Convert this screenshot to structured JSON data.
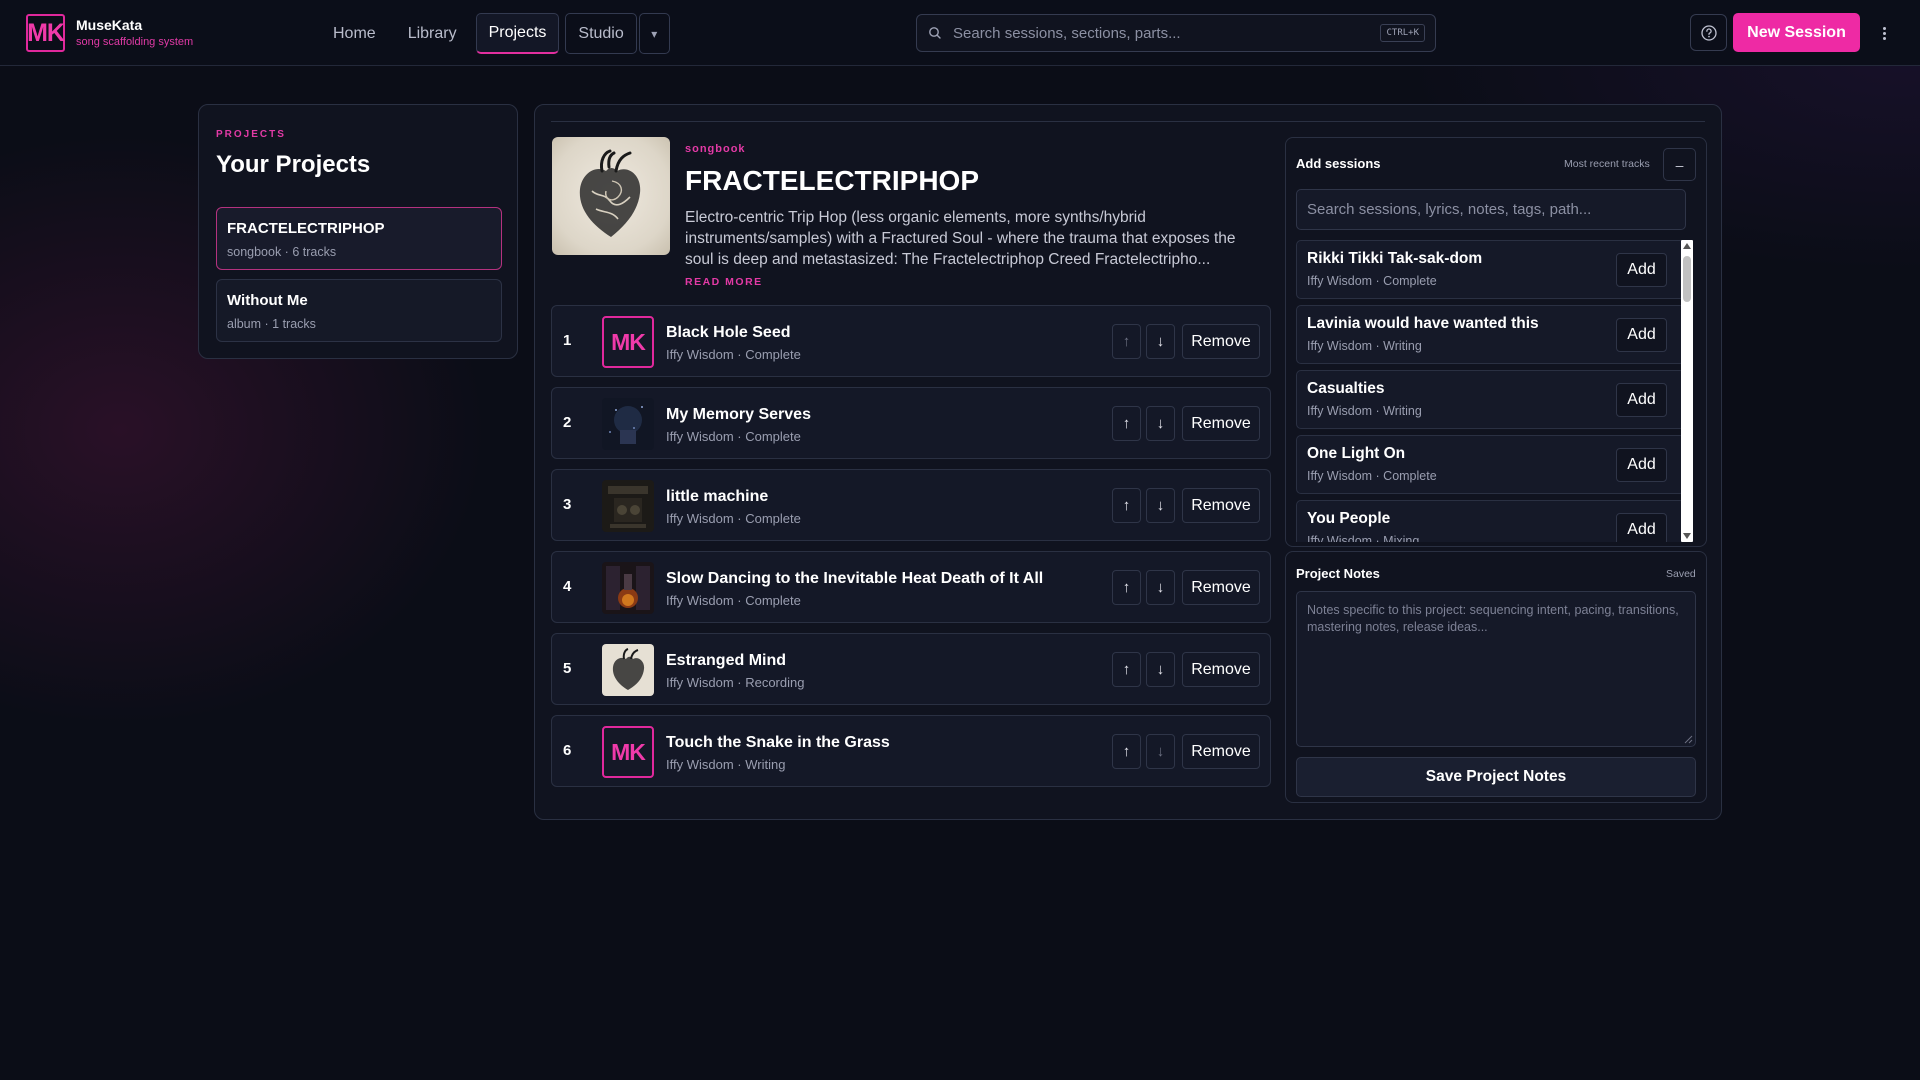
{
  "brand": {
    "logo_text": "MK",
    "name": "MuseKata",
    "tagline": "song scaffolding system"
  },
  "nav": {
    "items": [
      "Home",
      "Library",
      "Projects",
      "Studio"
    ],
    "active": "Projects",
    "more_glyph": "▾"
  },
  "search": {
    "placeholder": "Search sessions, sections, parts...",
    "shortcut": "CTRL+K"
  },
  "header_actions": {
    "help_icon": "help-circle-icon",
    "new_session_label": "New Session",
    "menu_icon": "kebab-menu-icon"
  },
  "sidebar": {
    "eyebrow": "PROJECTS",
    "title": "Your Projects",
    "projects": [
      {
        "name": "FRACTELECTRIPHOP",
        "meta": "songbook · 6 tracks",
        "active": true
      },
      {
        "name": "Without Me",
        "meta": "album · 1 tracks",
        "active": false
      }
    ]
  },
  "project": {
    "kind": "songbook",
    "title": "FRACTELECTRIPHOP",
    "description": "Electro-centric Trip Hop (less organic elements, more synths/hybrid instruments/samples) with a Fractured Soul - where the trauma that exposes the soul is deep and metastasized: The Fractelectriphop Creed Fractelectripho...",
    "read_more": "READ MORE"
  },
  "tracks": [
    {
      "num": "1",
      "title": "Black Hole Seed",
      "meta": "Iffy Wisdom · Complete",
      "thumb": "mk"
    },
    {
      "num": "2",
      "title": "My Memory Serves",
      "meta": "Iffy Wisdom · Complete",
      "thumb": "art-night"
    },
    {
      "num": "3",
      "title": "little machine",
      "meta": "Iffy Wisdom · Complete",
      "thumb": "art-machine"
    },
    {
      "num": "4",
      "title": "Slow Dancing to the Inevitable Heat Death of It All",
      "meta": "Iffy Wisdom · Complete",
      "thumb": "art-fire"
    },
    {
      "num": "5",
      "title": "Estranged Mind",
      "meta": "Iffy Wisdom · Recording",
      "thumb": "art-heart"
    },
    {
      "num": "6",
      "title": "Touch the Snake in the Grass",
      "meta": "Iffy Wisdom · Writing",
      "thumb": "mk"
    }
  ],
  "track_actions": {
    "up_glyph": "↑",
    "down_glyph": "↓",
    "remove_label": "Remove"
  },
  "add_sessions": {
    "title": "Add sessions",
    "subtitle": "Most recent tracks",
    "collapse_glyph": "–",
    "search_placeholder": "Search sessions, lyrics, notes, tags, path...",
    "add_label": "Add",
    "items": [
      {
        "name": "Rikki Tikki Tak-sak-dom",
        "meta": "Iffy Wisdom · Complete"
      },
      {
        "name": "Lavinia would have wanted this",
        "meta": "Iffy Wisdom · Writing"
      },
      {
        "name": "Casualties",
        "meta": "Iffy Wisdom · Writing"
      },
      {
        "name": "One Light On",
        "meta": "Iffy Wisdom · Complete"
      },
      {
        "name": "You People",
        "meta": "Iffy Wisdom · Mixing"
      }
    ]
  },
  "notes": {
    "title": "Project Notes",
    "status": "Saved",
    "placeholder": "Notes specific to this project: sequencing intent, pacing, transitions, mastering notes, release ideas...",
    "save_label": "Save Project Notes"
  },
  "colors": {
    "accent": "#ee2aa4",
    "background": "#0b0d17",
    "panel": "#10131f",
    "border": "#2a3042"
  }
}
